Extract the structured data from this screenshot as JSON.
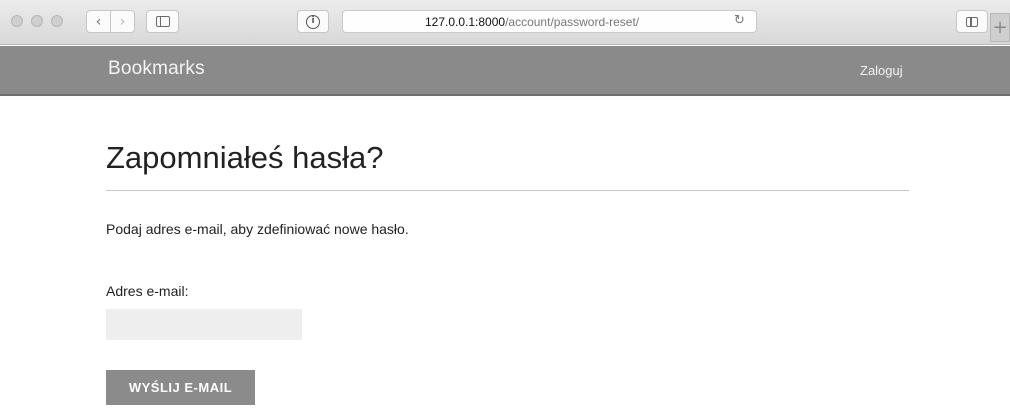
{
  "browser": {
    "url_host": "127.0.0.1:8000",
    "url_path": "/account/password-reset/",
    "icons": {
      "back": "chevron-left-icon",
      "forward": "chevron-right-icon",
      "sidebar": "sidebar-icon",
      "privacy": "info-icon",
      "reload": "reload-icon",
      "tabs": "tabs-overview-icon",
      "new_tab": "plus-icon"
    },
    "glyphs": {
      "back": "‹",
      "forward": "›",
      "reload": "↻",
      "new_tab": "+"
    }
  },
  "site": {
    "logo": "Bookmarks",
    "login_link": "Zaloguj",
    "header_color": "#8a8a8a"
  },
  "main": {
    "title": "Zapomniałeś hasła?",
    "intro": "Podaj adres e-mail, aby zdefiniować nowe hasło.",
    "email_label": "Adres e-mail:",
    "email_value": "",
    "email_placeholder": "",
    "submit_label": "WYŚLIJ E-MAIL"
  }
}
